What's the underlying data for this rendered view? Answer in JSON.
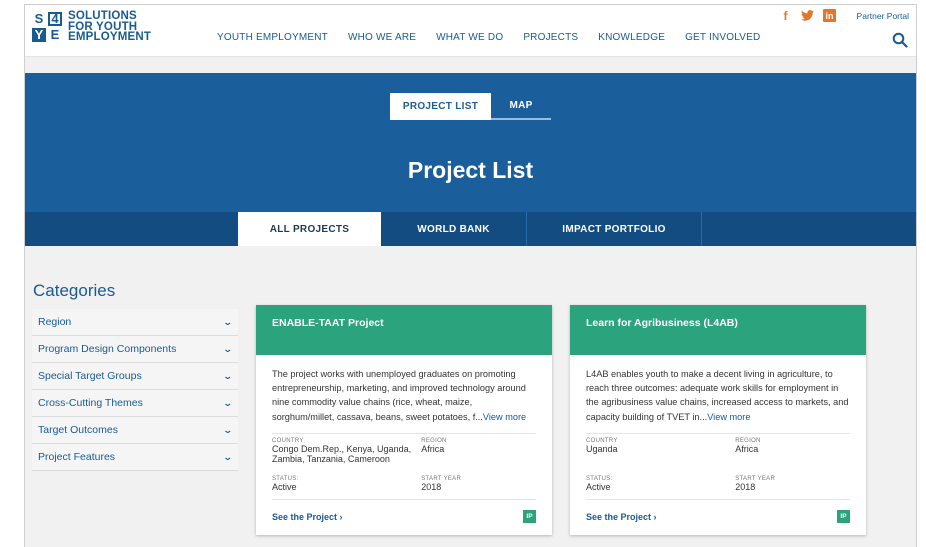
{
  "logo": {
    "letters": [
      "S",
      "4",
      "Y",
      "E"
    ],
    "text_lines": [
      "SOLUTIONS",
      "FOR YOUTH",
      "EMPLOYMENT"
    ]
  },
  "nav": [
    "YOUTH EMPLOYMENT",
    "WHO WE ARE",
    "WHAT WE DO",
    "PROJECTS",
    "KNOWLEDGE",
    "GET INVOLVED"
  ],
  "social": {
    "facebook": "f",
    "twitter": "t",
    "linkedin": "in"
  },
  "partner_portal": "Partner Portal",
  "view_toggle": {
    "list": "PROJECT LIST",
    "map": "MAP"
  },
  "page_title": "Project List",
  "tabs": [
    "ALL PROJECTS",
    "WORLD BANK",
    "IMPACT PORTFOLIO"
  ],
  "categories": {
    "title": "Categories",
    "items": [
      "Region",
      "Program Design Components",
      "Special Target Groups",
      "Cross-Cutting Themes",
      "Target Outcomes",
      "Project Features"
    ]
  },
  "cards": [
    {
      "title": "ENABLE-TAAT Project",
      "description": "The project works with unemployed graduates on promoting entrepreneurship, marketing, and improved technology around nine commodity value chains (rice, wheat, maize, sorghum/millet, cassava, beans, sweet potatoes, f...",
      "more": "View more",
      "country_label": "COUNTRY",
      "country": "Congo Dem.Rep., Kenya, Uganda, Zambia, Tanzania, Cameroon",
      "region_label": "REGION",
      "region": "Africa",
      "status_label": "STATUS:",
      "status": "Active",
      "start_label": "START YEAR",
      "start_year": "2018",
      "link": "See the Project",
      "badge": "IP"
    },
    {
      "title": "Learn for Agribusiness (L4AB)",
      "description": "L4AB enables youth to make a decent living in agriculture, to reach three outcomes: adequate work skills for employment in the agribusiness value chains, increased access to markets, and capacity building of TVET in...",
      "more": "View more",
      "country_label": "COUNTRY",
      "country": "Uganda",
      "region_label": "REGION",
      "region": "Africa",
      "status_label": "STATUS:",
      "status": "Active",
      "start_label": "START YEAR",
      "start_year": "2018",
      "link": "See the Project",
      "badge": "IP"
    }
  ],
  "colors": {
    "brand_blue": "#1a5f9b",
    "dark_blue": "#134c80",
    "green": "#2ba37c",
    "orange": "#e4762b"
  }
}
